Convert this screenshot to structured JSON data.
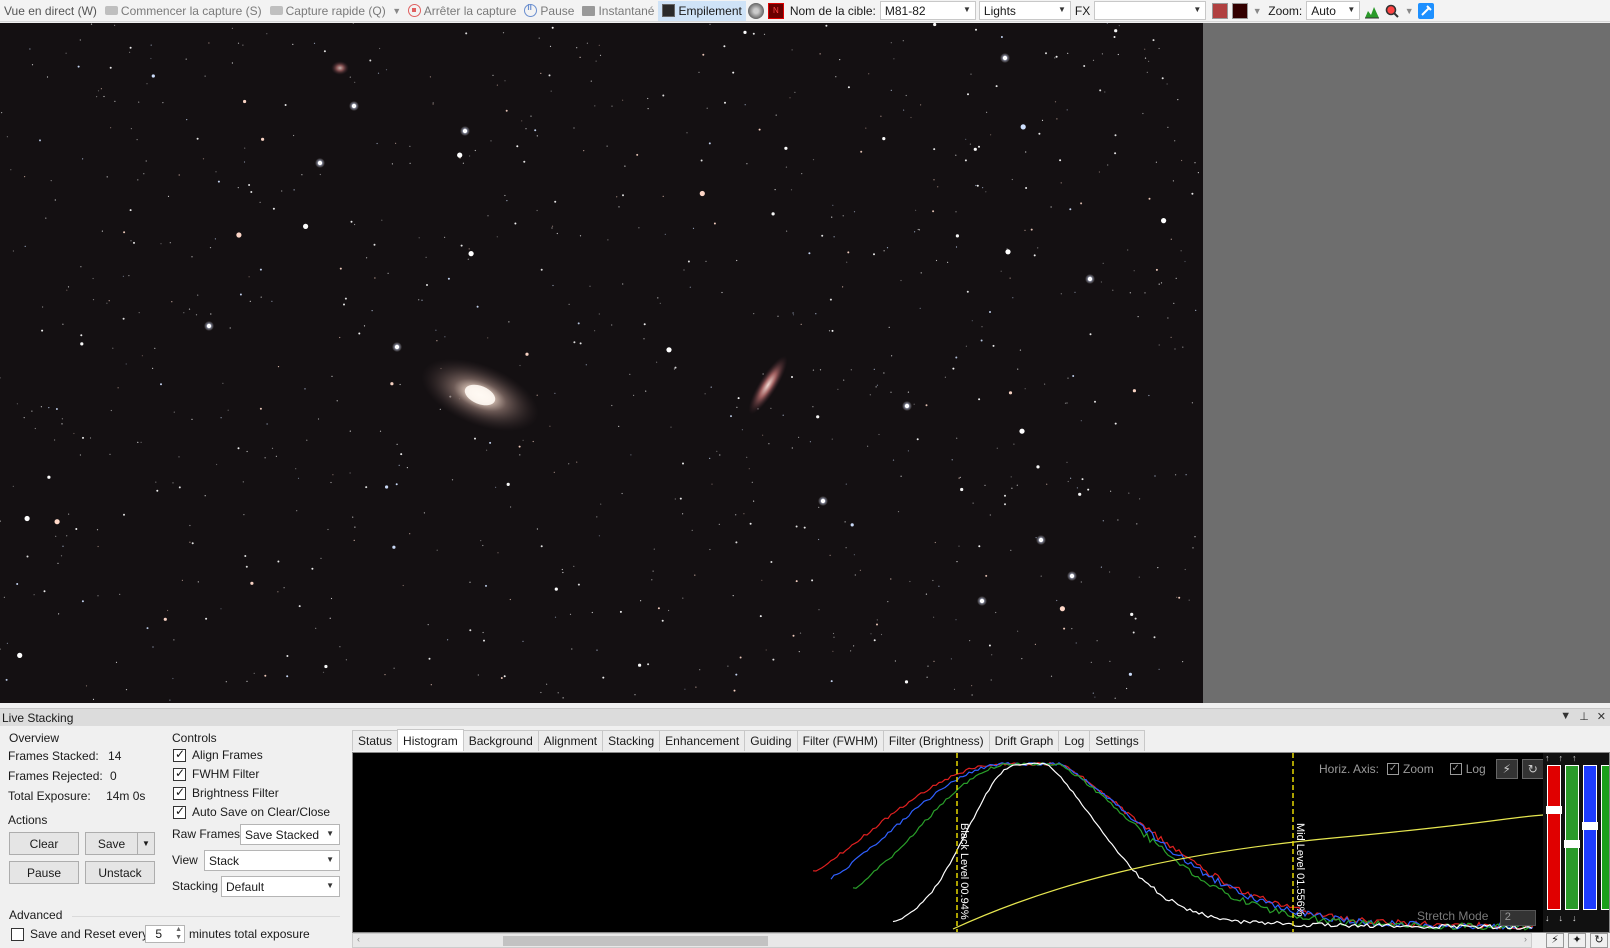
{
  "toolbar": {
    "live_view": "Vue en direct (W)",
    "start_capture": "Commencer la capture (S)",
    "quick_capture": "Capture rapide (Q)",
    "stop_capture": "Arrêter la capture",
    "pause": "Pause",
    "snapshot": "Instantané",
    "stacking": "Empilement",
    "target_label": "Nom de la cible:",
    "target_value": "M81-82",
    "frame_type": "Lights",
    "fx_label": "FX",
    "fx_value": "",
    "zoom_label": "Zoom:",
    "zoom_value": "Auto",
    "icons": [
      "camera-icon",
      "record-icon",
      "pause-icon",
      "snapshot-icon",
      "stack-icon",
      "histogram-icon",
      "magnifier-icon"
    ]
  },
  "dock": {
    "title": "Live Stacking",
    "overview": {
      "title": "Overview",
      "frames_stacked_label": "Frames Stacked:",
      "frames_stacked": "14",
      "frames_rejected_label": "Frames Rejected:",
      "frames_rejected": "0",
      "total_exposure_label": "Total Exposure:",
      "total_exposure": "14m 0s"
    },
    "actions": {
      "title": "Actions",
      "clear": "Clear",
      "save": "Save",
      "pause": "Pause",
      "unstack": "Unstack"
    },
    "advanced": {
      "title": "Advanced",
      "save_reset_label": "Save and Reset every",
      "save_reset_value": "5",
      "save_reset_suffix": "minutes total exposure",
      "save_reset_checked": false
    },
    "controls": {
      "title": "Controls",
      "align_frames": "Align Frames",
      "fwhm_filter": "FWHM Filter",
      "brightness_filter": "Brightness Filter",
      "auto_save": "Auto Save on Clear/Close",
      "raw_frames_label": "Raw Frames",
      "raw_frames_value": "Save Stacked",
      "view_label": "View",
      "view_value": "Stack",
      "stacking_label": "Stacking",
      "stacking_value": "Default"
    },
    "tabs": [
      "Status",
      "Histogram",
      "Background",
      "Alignment",
      "Stacking",
      "Enhancement",
      "Guiding",
      "Filter (FWHM)",
      "Filter (Brightness)",
      "Drift Graph",
      "Log",
      "Settings"
    ],
    "active_tab": "Histogram",
    "histogram": {
      "horiz_axis_label": "Horiz. Axis:",
      "zoom_label": "Zoom",
      "log_label": "Log",
      "black_level": "Black Level  00.94%",
      "mid_level": "Mid Level  01.556%",
      "stretch_mode_label": "Stretch Mode",
      "stretch_mode_value": "2",
      "colors": {
        "red": "#e02020",
        "green": "#2aa02a",
        "blue": "#3060ff",
        "white": "#ffffff",
        "curve": "#e6e650",
        "level": "#e6d800"
      }
    }
  }
}
